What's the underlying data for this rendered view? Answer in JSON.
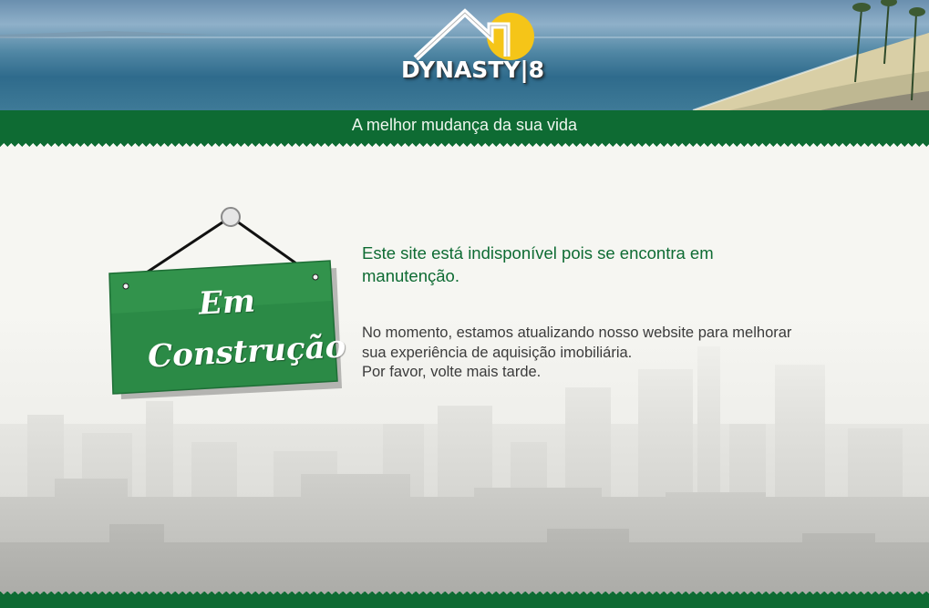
{
  "brand": {
    "name": "DYNASTY 8",
    "logo_text": "DYNASTY",
    "logo_number": "8",
    "accent_color": "#f5c518",
    "green_color": "#0e6b33"
  },
  "header": {
    "tagline": "A melhor mudança da sua vida"
  },
  "sign": {
    "line1": "Em",
    "line2": "Construção"
  },
  "message": {
    "headline": "Este site está indisponível pois se encontra em manutenção.",
    "body_line1": "No momento, estamos atualizando nosso website para melhorar",
    "body_line2": "sua experiência de aquisição imobiliária.",
    "body_line3": "Por favor, volte mais tarde."
  }
}
